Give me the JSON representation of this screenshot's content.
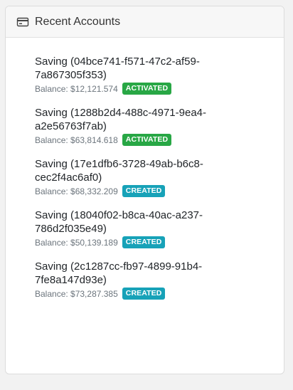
{
  "header": {
    "title": "Recent Accounts",
    "icon": "credit-card-icon"
  },
  "accounts": [
    {
      "name": "Saving (04bce741-f571-47c2-af59-7a867305f353)",
      "balance": "Balance: $12,121.574",
      "status": "ACTIVATED",
      "status_color": "#28a745"
    },
    {
      "name": "Saving (1288b2d4-488c-4971-9ea4-a2e56763f7ab)",
      "balance": "Balance: $63,814.618",
      "status": "ACTIVATED",
      "status_color": "#28a745"
    },
    {
      "name": "Saving (17e1dfb6-3728-49ab-b6c8-cec2f4ac6af0)",
      "balance": "Balance: $68,332.209",
      "status": "CREATED",
      "status_color": "#17a2b8"
    },
    {
      "name": "Saving (18040f02-b8ca-40ac-a237-786d2f035e49)",
      "balance": "Balance: $50,139.189",
      "status": "CREATED",
      "status_color": "#17a2b8"
    },
    {
      "name": "Saving (2c1287cc-fb97-4899-91b4-7fe8a147d93e)",
      "balance": "Balance: $73,287.385",
      "status": "CREATED",
      "status_color": "#17a2b8"
    }
  ]
}
